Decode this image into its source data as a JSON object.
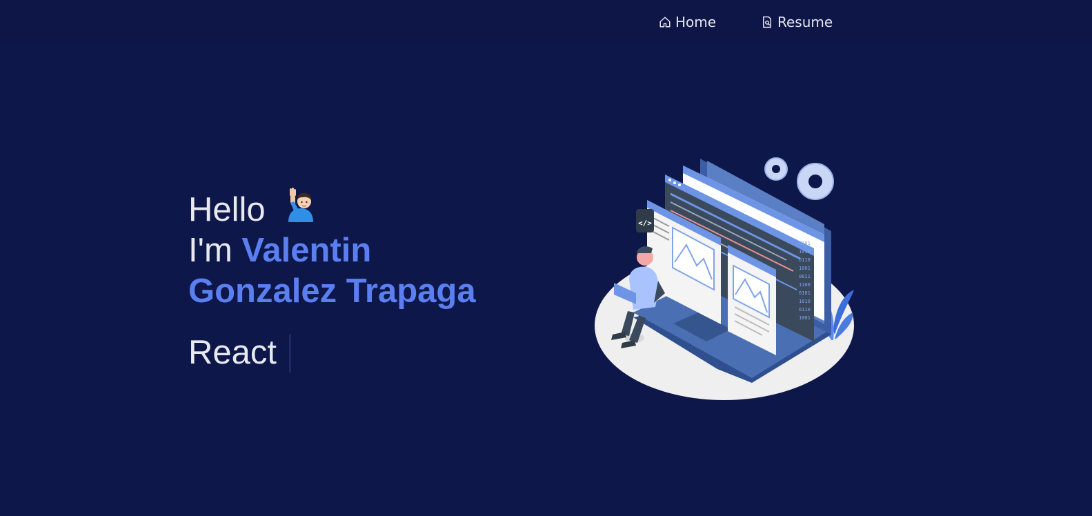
{
  "nav": {
    "home_label": "Home",
    "home_icon": "home-icon",
    "resume_label": "Resume",
    "resume_icon": "document-search-icon"
  },
  "hero": {
    "greeting": "Hello",
    "greeting_emoji": "man-raising-hand-icon",
    "intro_prefix": "I'm",
    "first_name": "Valentin",
    "last_names": "Gonzalez Trapaga",
    "typed_text": "React"
  },
  "illustration": {
    "icon": "developer-laptop-illustration",
    "code_badge": "</>"
  },
  "colors": {
    "background": "#0e174a",
    "accent": "#5b7ff0",
    "text": "#e8e9ef"
  }
}
